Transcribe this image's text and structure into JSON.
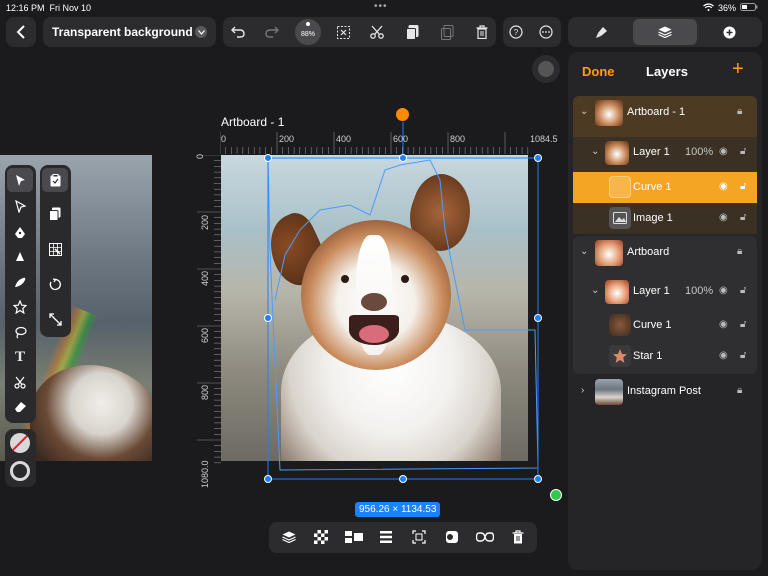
{
  "status_bar": {
    "time": "12:16 PM",
    "date": "Fri Nov 10",
    "battery": "36%"
  },
  "header": {
    "title": "Transparent background",
    "zoom": "88%"
  },
  "artboard": {
    "title": "Artboard - 1",
    "dimension_badge": "956.26 × 1134.53"
  },
  "ruler": {
    "top_labels": [
      "0",
      "200",
      "400",
      "600",
      "800",
      "1084.5"
    ],
    "left_labels": [
      "0",
      "200",
      "400",
      "600",
      "800",
      "1080.0"
    ]
  },
  "panel": {
    "done_label": "Done",
    "title": "Layers",
    "add_label": "+",
    "layers": [
      {
        "name": "Artboard - 1",
        "opacity": ""
      },
      {
        "name": "Layer 1",
        "opacity": "100%"
      },
      {
        "name": "Curve 1",
        "opacity": ""
      },
      {
        "name": "Image 1",
        "opacity": ""
      },
      {
        "name": "Artboard",
        "opacity": ""
      },
      {
        "name": "Layer 1",
        "opacity": "100%"
      },
      {
        "name": "Curve 1",
        "opacity": ""
      },
      {
        "name": "Star 1",
        "opacity": ""
      },
      {
        "name": "Instagram Post",
        "opacity": ""
      }
    ]
  },
  "colors": {
    "accent": "#ff9f0a",
    "selection": "#1a82ff",
    "panel_bg": "#252527",
    "selected_row": "#f5a524"
  }
}
